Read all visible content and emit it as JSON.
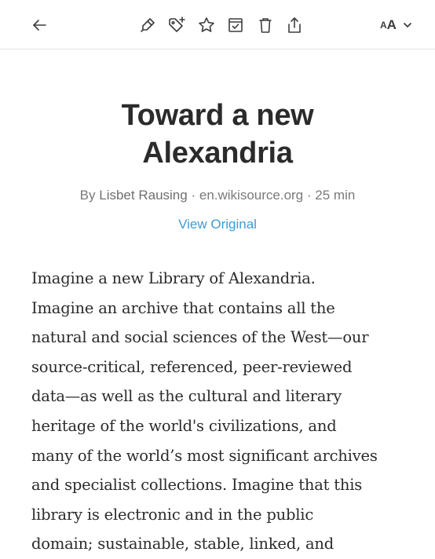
{
  "toolbar": {
    "icons": {
      "back": "arrow-left-icon",
      "highlight": "highlighter-icon",
      "tag": "tag-add-icon",
      "favorite": "star-icon",
      "archive": "archive-icon",
      "delete": "trash-icon",
      "share": "share-icon",
      "text_settings": "text-size-icon"
    },
    "text_size_small": "A",
    "text_size_big": "A"
  },
  "article": {
    "title_line1": "Toward a new",
    "title_line2": "Alexandria",
    "byline_prefix": "By",
    "author": "Lisbet Rausing",
    "source": "en.wikisource.org",
    "read_time": "25 min",
    "separator": "·",
    "view_original": "View Original",
    "body_lines": [
      "Imagine a new Library of Alexandria.",
      "Imagine an archive that contains all the",
      "natural and social sciences of the West—our",
      "source-critical, referenced, peer-reviewed",
      "data—as well as the cultural and literary",
      "heritage of the world's civilizations, and",
      "many of the world’s most significant archives",
      "and specialist collections. Imagine that this",
      "library is electronic and in the public",
      "domain; sustainable, stable, linked, and"
    ]
  },
  "colors": {
    "link": "#3e9bd6",
    "text": "#2b2b2b",
    "meta": "#7a7a7a",
    "divider": "#e4e4e4"
  }
}
